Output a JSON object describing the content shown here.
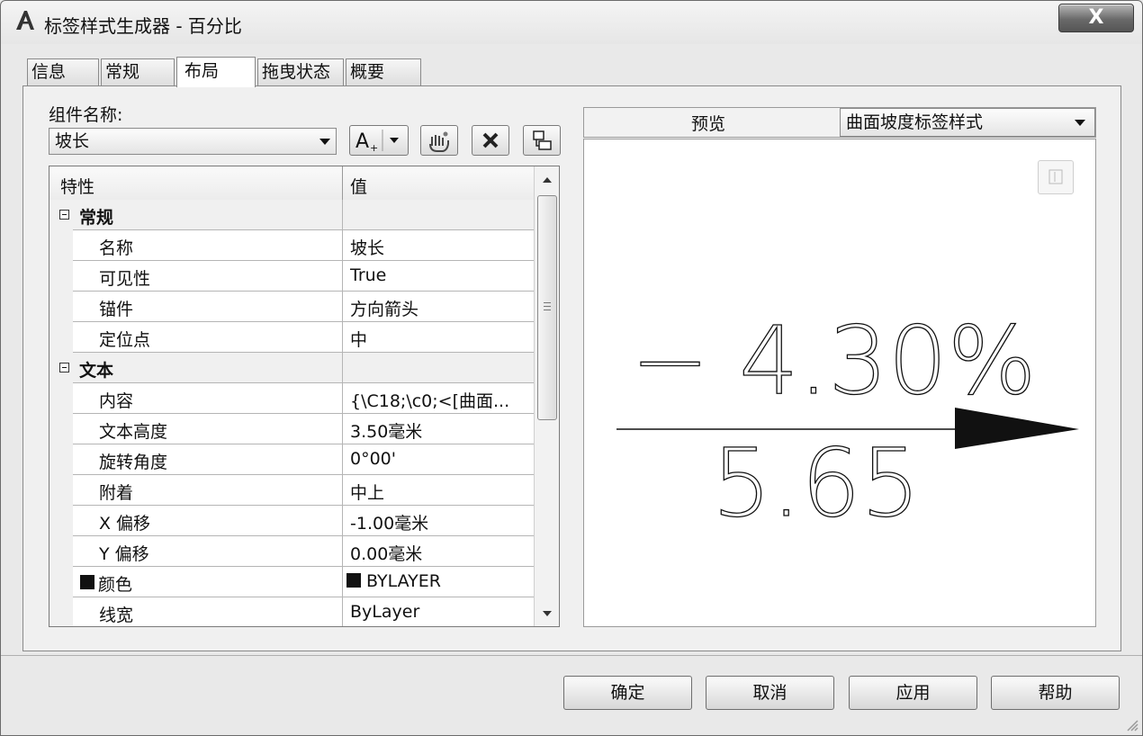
{
  "window": {
    "title": "标签样式生成器 - 百分比",
    "close_label": "X"
  },
  "tabs": [
    {
      "label": "信息",
      "active": false
    },
    {
      "label": "常规",
      "active": false
    },
    {
      "label": "布局",
      "active": true
    },
    {
      "label": "拖曳状态",
      "active": false
    },
    {
      "label": "概要",
      "active": false
    }
  ],
  "component": {
    "label": "组件名称:",
    "value": "坡长"
  },
  "toolbar": {
    "create_icon": "text-component-icon",
    "copy_icon": "copy-component-icon",
    "delete_icon": "delete-icon",
    "order_icon": "component-order-icon"
  },
  "grid": {
    "col_property": "特性",
    "col_value": "值",
    "rows": [
      {
        "type": "cat",
        "name": "常规"
      },
      {
        "type": "prop",
        "name": "名称",
        "value": "坡长"
      },
      {
        "type": "prop",
        "name": "可见性",
        "value": "True"
      },
      {
        "type": "prop",
        "name": "锚件",
        "value": "方向箭头"
      },
      {
        "type": "prop",
        "name": "定位点",
        "value": "中"
      },
      {
        "type": "cat",
        "name": "文本"
      },
      {
        "type": "prop",
        "name": "内容",
        "value": "{\\C18;\\c0;<[曲面..."
      },
      {
        "type": "prop",
        "name": "文本高度",
        "value": "3.50毫米"
      },
      {
        "type": "prop",
        "name": "旋转角度",
        "value": "0°00'"
      },
      {
        "type": "prop",
        "name": "附着",
        "value": "中上"
      },
      {
        "type": "prop",
        "name": "X 偏移",
        "value": "-1.00毫米"
      },
      {
        "type": "prop",
        "name": "Y 偏移",
        "value": "0.00毫米"
      },
      {
        "type": "prop",
        "name": "颜色",
        "value": "BYLAYER",
        "swatch": "#111111"
      },
      {
        "type": "prop",
        "name": "线宽",
        "value": "ByLayer"
      }
    ]
  },
  "preview": {
    "label": "预览",
    "style_value": "曲面坡度标签样式",
    "slope_text": "− 4.30%",
    "length_text": "5.65"
  },
  "buttons": {
    "ok": "确定",
    "cancel": "取消",
    "apply": "应用",
    "help": "帮助"
  }
}
